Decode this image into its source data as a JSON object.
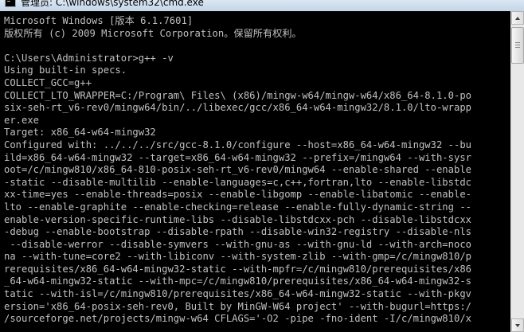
{
  "window": {
    "title": "管理员: C:\\windows\\system32\\cmd.exe"
  },
  "console": {
    "lines": [
      "Microsoft Windows [版本 6.1.7601]",
      "版权所有 (c) 2009 Microsoft Corporation。保留所有权利。",
      "",
      "C:\\Users\\Administrator>g++ -v",
      "Using built-in specs.",
      "COLLECT_GCC=g++",
      "COLLECT_LTO_WRAPPER=C:/Program\\ Files\\ (x86)/mingw-w64/mingw-w64/x86_64-8.1.0-po",
      "six-seh-rt_v6-rev0/mingw64/bin/../libexec/gcc/x86_64-w64-mingw32/8.1.0/lto-wrapp",
      "er.exe",
      "Target: x86_64-w64-mingw32",
      "Configured with: ../../../src/gcc-8.1.0/configure --host=x86_64-w64-mingw32 --bu",
      "ild=x86_64-w64-mingw32 --target=x86_64-w64-mingw32 --prefix=/mingw64 --with-sysr",
      "oot=/c/mingw810/x86_64-810-posix-seh-rt_v6-rev0/mingw64 --enable-shared --enable",
      "-static --disable-multilib --enable-languages=c,c++,fortran,lto --enable-libstdc",
      "xx-time=yes --enable-threads=posix --enable-libgomp --enable-libatomic --enable-",
      "lto --enable-graphite --enable-checking=release --enable-fully-dynamic-string --",
      "enable-version-specific-runtime-libs --disable-libstdcxx-pch --disable-libstdcxx",
      "-debug --enable-bootstrap --disable-rpath --disable-win32-registry --disable-nls",
      " --disable-werror --disable-symvers --with-gnu-as --with-gnu-ld --with-arch=noco",
      "na --with-tune=core2 --with-libiconv --with-system-zlib --with-gmp=/c/mingw810/p",
      "rerequisites/x86_64-w64-mingw32-static --with-mpfr=/c/mingw810/prerequisites/x86",
      "_64-w64-mingw32-static --with-mpc=/c/mingw810/prerequisites/x86_64-w64-mingw32-s",
      "tatic --with-isl=/c/mingw810/prerequisites/x86_64-w64-mingw32-static --with-pkgv",
      "ersion='x86_64-posix-seh-rev0, Built by MinGW-W64 project' --with-bugurl=https:/",
      "/sourceforge.net/projects/mingw-w64 CFLAGS='-O2 -pipe -fno-ident -I/c/mingw810/x"
    ]
  }
}
